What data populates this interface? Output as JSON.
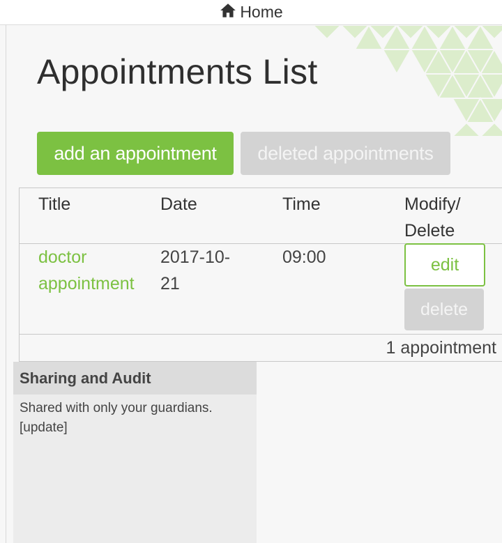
{
  "topbar": {
    "home_label": "Home",
    "home_icon": "home-icon"
  },
  "page": {
    "title": "Appointments List"
  },
  "actions": {
    "add_label": "add an appointment",
    "deleted_label": "deleted appointments"
  },
  "table": {
    "headers": {
      "title": "Title",
      "date": "Date",
      "time": "Time",
      "modify_line1": "Modify/",
      "modify_line2": "Delete"
    },
    "rows": [
      {
        "title_line1": "doctor",
        "title_line2": "appointment",
        "date_line1": "2017-10-",
        "date_line2": "21",
        "time": "09:00",
        "edit_label": "edit",
        "delete_label": "delete"
      }
    ],
    "count_label": "1 appointment"
  },
  "sharing": {
    "heading": "Sharing and Audit",
    "text": "Shared with only your guardians.",
    "update_link": "[update]"
  },
  "colors": {
    "accent": "#7cc142",
    "disabled": "#d3d3d3",
    "pattern": "#d9ebc9"
  }
}
